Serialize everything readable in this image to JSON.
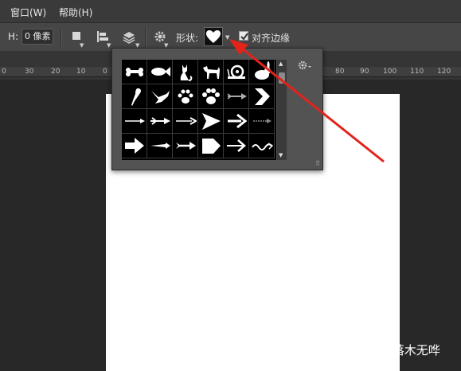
{
  "menubar": {
    "items": [
      {
        "label": "窗口(W)"
      },
      {
        "label": "帮助(H)"
      }
    ]
  },
  "options": {
    "h_label": "H:",
    "h_value": "0 像素",
    "shape_label": "形状:",
    "align_edges_label": "对齐边缘",
    "align_edges_checked": true
  },
  "ruler": {
    "ticks": [
      "0",
      "30",
      "20",
      "10",
      "0",
      "80",
      "90",
      "100",
      "110",
      "120"
    ]
  },
  "shape_picker": {
    "shapes": [
      "bone-icon",
      "fish-icon",
      "cat-icon",
      "dog-icon",
      "snail-icon",
      "rabbit-icon",
      "bird-icon",
      "dove-icon",
      "paw-print-icon",
      "paw-print-2-icon",
      "arrow-feather-icon",
      "chevron-right-icon",
      "arrow-thin-icon",
      "arrow-double-icon",
      "arrow-plain-icon",
      "arrowhead-icon",
      "arrow-bold-icon",
      "arrow-dotted-icon",
      "arrow-block-icon",
      "arrow-slim-icon",
      "arrow-fletched-icon",
      "pentagon-arrow-icon",
      "arrow-right-icon",
      "wave-icon"
    ]
  },
  "watermark": "知乎 @落木无哗",
  "colors": {
    "annotation_arrow": "#e2231a",
    "document": "#ffffff"
  }
}
